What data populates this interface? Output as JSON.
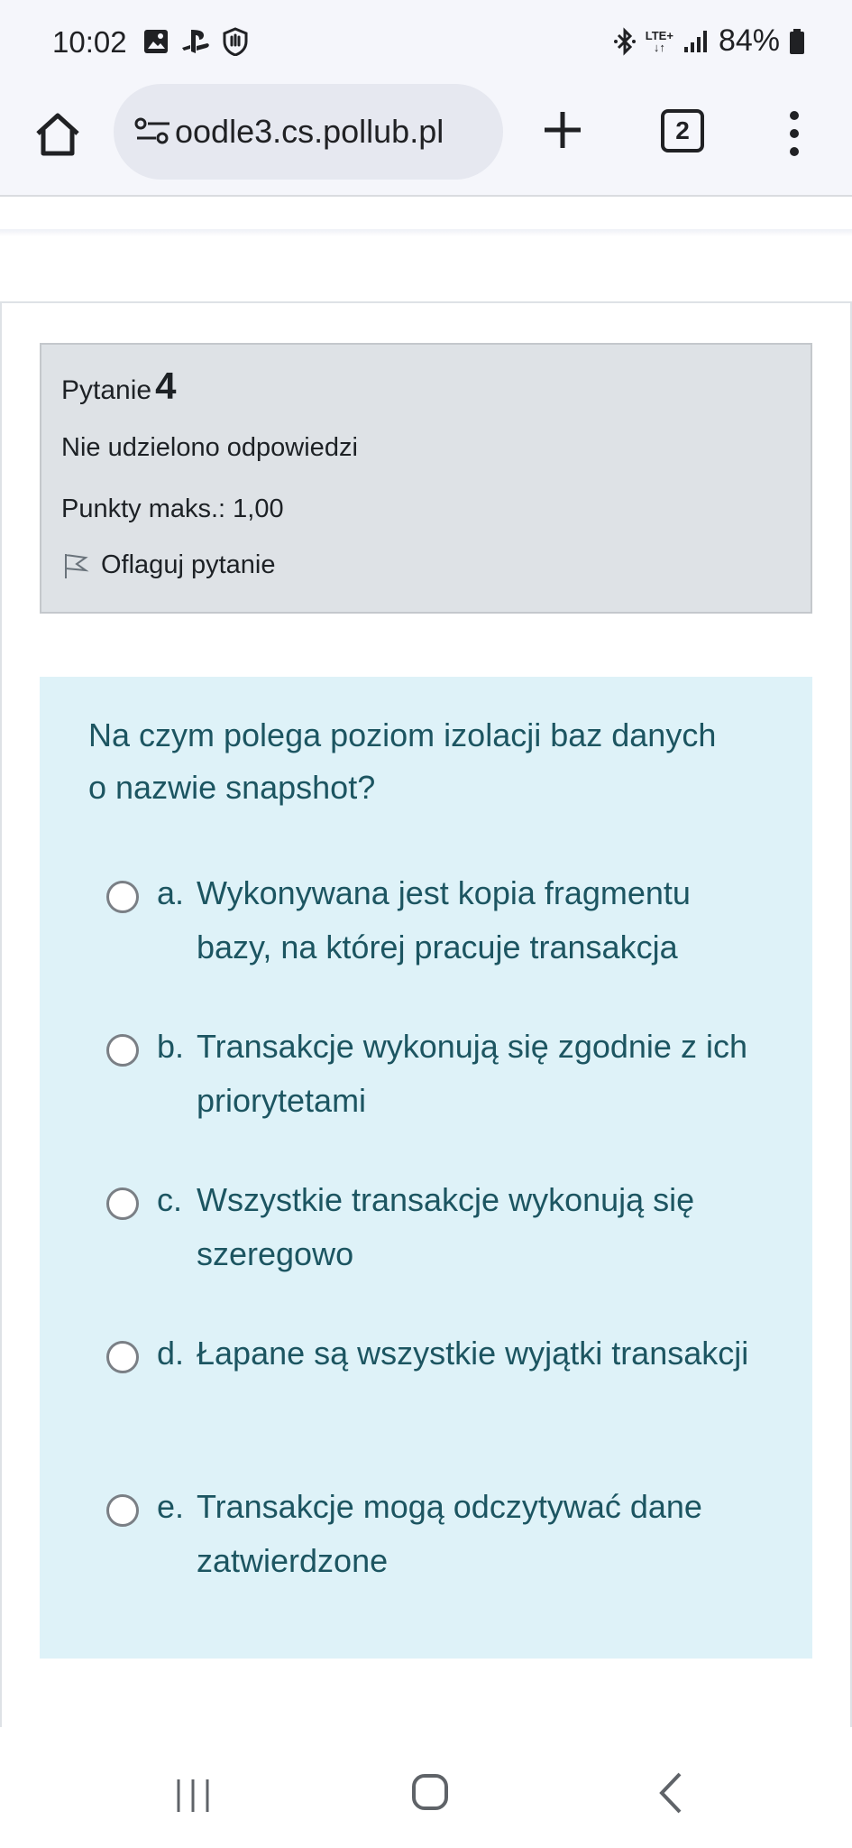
{
  "status_bar": {
    "time": "10:02",
    "network": "LTE+",
    "battery": "84%"
  },
  "browser": {
    "url": "oodle3.cs.pollub.pl",
    "tab_count": "2"
  },
  "question_info": {
    "label": "Pytanie",
    "number": "4",
    "state": "Nie udzielono odpowiedzi",
    "grade": "Punkty maks.: 1,00",
    "flag_label": "Oflaguj pytanie"
  },
  "question": {
    "text": "Na czym polega poziom izolacji baz danych o nazwie snapshot?",
    "answers": [
      {
        "letter": "a.",
        "text": "Wykonywana jest kopia fragmentu bazy, na której pracuje transakcja"
      },
      {
        "letter": "b.",
        "text": "Transakcje wykonują się zgodnie z ich priorytetami"
      },
      {
        "letter": "c.",
        "text": "Wszystkie transakcje wykonują się szeregowo"
      },
      {
        "letter": "d.",
        "text": "Łapane są wszystkie wyjątki transakcji"
      },
      {
        "letter": "e.",
        "text": "Transakcje mogą odczytywać dane zatwierdzone"
      }
    ]
  },
  "colors": {
    "formulation_bg": "#def2f8",
    "question_text": "#1c5561",
    "info_bg": "#dee2e6"
  }
}
